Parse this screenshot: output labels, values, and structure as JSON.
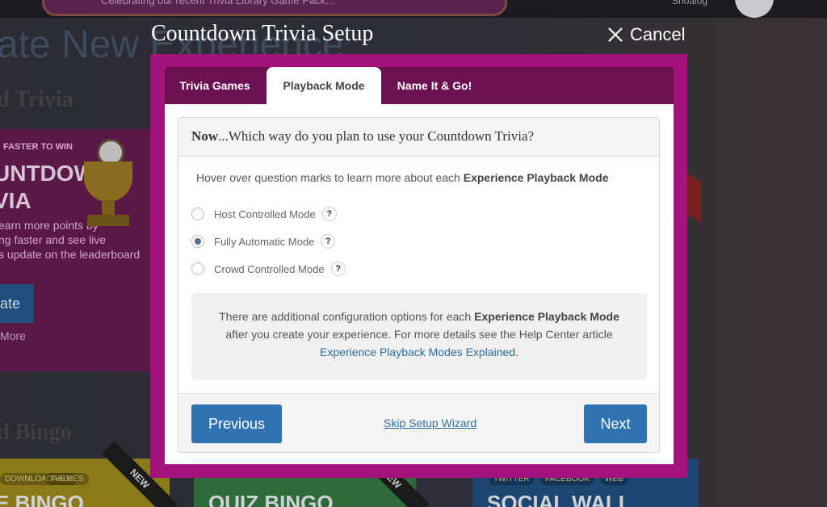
{
  "background": {
    "banner_text": "Celebrating our recent Trivia Library Game Pack...",
    "user_name": "Shoalog",
    "page_title": "ate New Experience",
    "section_trivia": "d Trivia",
    "trivia_card": {
      "eyebrow": "FASTER TO WIN",
      "heading": "UNTDOWN\nVIA",
      "description": "earn more points by\nng faster and see live\ns update on the leaderboard",
      "create_label": "ate",
      "more_label": "More"
    },
    "section_bingo": "d Bingo",
    "bingo_cards": [
      {
        "tags": [
          "DOWNLOADABLE",
          "THEMES"
        ],
        "label": "E BINGO",
        "ribbon": "NEW"
      },
      {
        "tags": [],
        "label": "QUIZ BINGO",
        "ribbon": "NEW"
      },
      {
        "tags": [
          "TWITTER",
          "FACEBOOK",
          "WEB"
        ],
        "label": "SOCIAL WALL",
        "ribbon": ""
      }
    ]
  },
  "modal": {
    "title": "Countdown Trivia Setup",
    "cancel_label": "Cancel",
    "tabs": [
      {
        "label": "Trivia Games",
        "active": false
      },
      {
        "label": "Playback Mode",
        "active": true
      },
      {
        "label": "Name It & Go!",
        "active": false
      }
    ],
    "question_bold": "Now",
    "question_rest": "...Which way do you plan to use your Countdown Trivia?",
    "hint_text": "Hover over question marks to learn more about each ",
    "hint_bold": "Experience Playback Mode",
    "modes": [
      {
        "label": "Host Controlled Mode",
        "checked": false
      },
      {
        "label": "Fully Automatic Mode",
        "checked": true
      },
      {
        "label": "Crowd Controlled Mode",
        "checked": false
      }
    ],
    "help_mark": "?",
    "info": {
      "text1": "There are additional configuration options for each ",
      "bold": "Experience Playback Mode",
      "text2": " after you create your experience. For more details see the Help Center article ",
      "link": "Experience Playback Modes Explained",
      "text3": "."
    },
    "previous_label": "Previous",
    "skip_label": "Skip Setup Wizard",
    "next_label": "Next"
  },
  "colors": {
    "frame": "#a3117a",
    "tab_bar": "#6b1050",
    "primary_button": "#3172b0",
    "link": "#2e6da4"
  }
}
